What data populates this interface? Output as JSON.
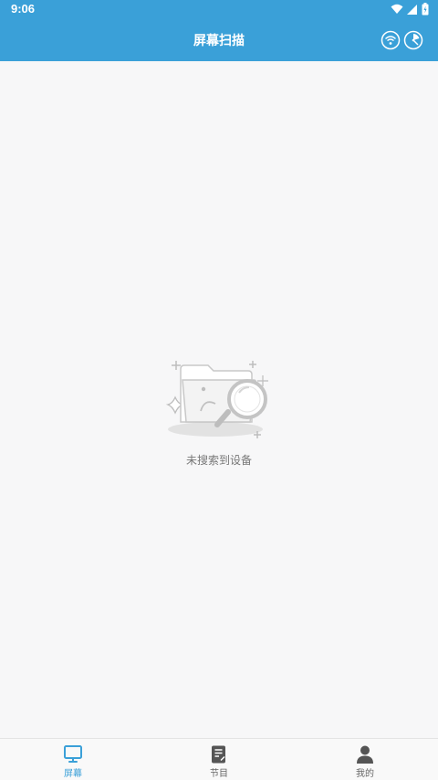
{
  "status_bar": {
    "time": "9:06",
    "icons": [
      "wifi-icon",
      "signal-icon",
      "battery-icon"
    ]
  },
  "header": {
    "title": "屏幕扫描",
    "actions": [
      "wifi-scan-icon",
      "radar-icon"
    ]
  },
  "empty_state": {
    "icon": "folder-search-icon",
    "message": "未搜索到设备"
  },
  "bottom_nav": {
    "items": [
      {
        "label": "屏幕",
        "icon": "monitor-icon",
        "active": true
      },
      {
        "label": "节目",
        "icon": "document-icon",
        "active": false
      },
      {
        "label": "我的",
        "icon": "user-icon",
        "active": false
      }
    ]
  },
  "colors": {
    "primary": "#3aa0d8",
    "background": "#f7f7f8",
    "text_muted": "#777777"
  }
}
